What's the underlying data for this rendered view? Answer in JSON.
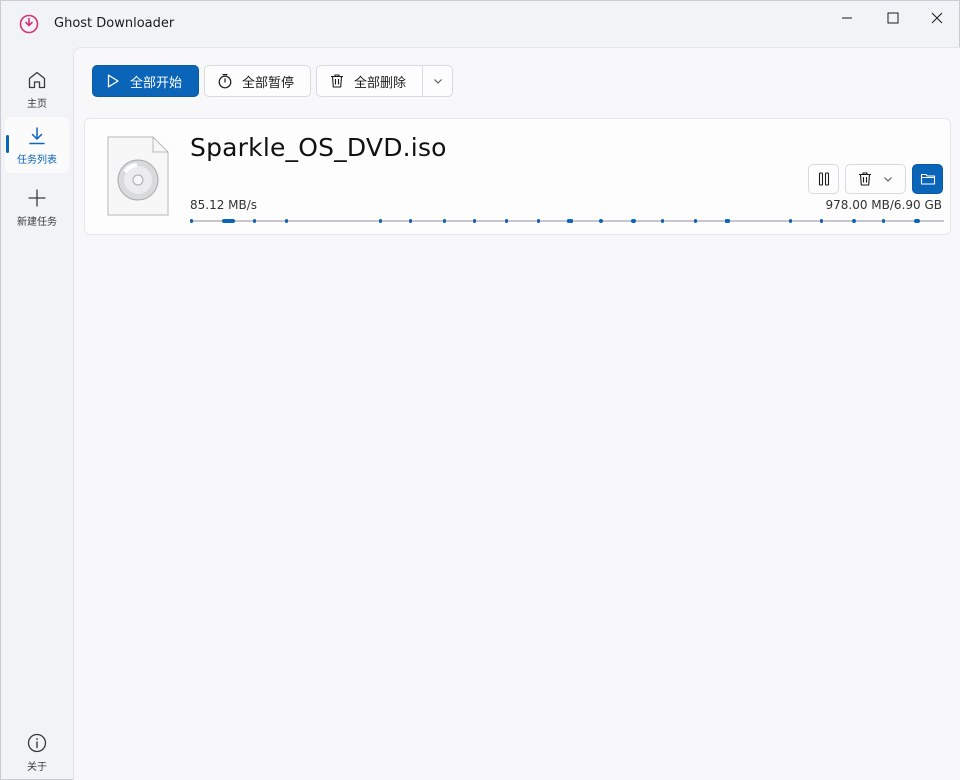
{
  "window": {
    "title": "Ghost Downloader",
    "accent": "#0a64b8",
    "app_icon_color": "#d6337a"
  },
  "sidebar": {
    "items": [
      {
        "label": "主页",
        "icon": "home-icon",
        "active": false
      },
      {
        "label": "任务列表",
        "icon": "download-icon",
        "active": true
      },
      {
        "label": "新建任务",
        "icon": "plus-icon",
        "active": false
      }
    ],
    "footer": {
      "label": "关于",
      "icon": "info-icon"
    }
  },
  "toolbar": {
    "start_all_label": "全部开始",
    "pause_all_label": "全部暂停",
    "delete_all_label": "全部删除"
  },
  "task": {
    "file_name": "Sparkle_OS_DVD.iso",
    "speed": "85.12 MB/s",
    "size_info": "978.00 MB/6.90 GB",
    "file_icon": "disc-file-icon",
    "progress_segments": [
      [
        0.0,
        0.004
      ],
      [
        0.043,
        0.06
      ],
      [
        0.083,
        0.087
      ],
      [
        0.126,
        0.13
      ],
      [
        0.25,
        0.253
      ],
      [
        0.29,
        0.293
      ],
      [
        0.335,
        0.338
      ],
      [
        0.375,
        0.379
      ],
      [
        0.418,
        0.422
      ],
      [
        0.46,
        0.463
      ],
      [
        0.5,
        0.504
      ],
      [
        0.502,
        0.505
      ],
      [
        0.504,
        0.508
      ],
      [
        0.542,
        0.548
      ],
      [
        0.585,
        0.592
      ],
      [
        0.625,
        0.629
      ],
      [
        0.668,
        0.672
      ],
      [
        0.71,
        0.713
      ],
      [
        0.712,
        0.715
      ],
      [
        0.71,
        0.713
      ],
      [
        0.795,
        0.798
      ],
      [
        0.835,
        0.839
      ],
      [
        0.878,
        0.883
      ],
      [
        0.918,
        0.921
      ],
      [
        0.96,
        0.968
      ]
    ]
  }
}
